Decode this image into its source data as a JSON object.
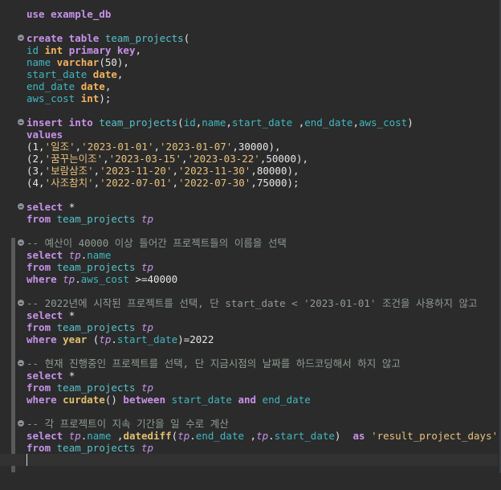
{
  "editor": {
    "lines": {
      "l1": [
        "use example_db"
      ],
      "l3": [
        "create table ",
        "team_projects",
        "("
      ],
      "l4": [
        "id ",
        "int ",
        "primary key",
        ","
      ],
      "l5": [
        "name ",
        "varchar",
        "(50),"
      ],
      "l6": [
        "start_date ",
        "date",
        ","
      ],
      "l7": [
        "end_date ",
        "date",
        ","
      ],
      "l8": [
        "aws_cost ",
        "int",
        ");"
      ],
      "l10": [
        "insert into ",
        "team_projects",
        "(",
        "id",
        ",",
        "name",
        ",",
        "start_date ",
        ",",
        "end_date",
        ",",
        "aws_cost",
        ")"
      ],
      "l11": [
        "values"
      ],
      "l12": [
        "(1,",
        "'일조'",
        ",",
        "'2023-01-01'",
        ",",
        "'2023-01-07'",
        ",30000),"
      ],
      "l13": [
        "(2,",
        "'꿈꾸는이조'",
        ",",
        "'2023-03-15'",
        ",",
        "'2023-03-22'",
        ",50000),"
      ],
      "l14": [
        "(3,",
        "'보람삼조'",
        ",",
        "'2023-11-20'",
        ",",
        "'2023-11-30'",
        ",80000),"
      ],
      "l15": [
        "(4,",
        "'사조참치'",
        ",",
        "'2022-07-01'",
        ",",
        "'2022-07-30'",
        ",75000);"
      ],
      "l17": [
        "select ",
        "*"
      ],
      "l18": [
        "from ",
        "team_projects ",
        "tp"
      ],
      "l20": [
        "-- 예산이 40000 이상 들어간 프로젝트들의 이름을 선택"
      ],
      "l21": [
        "select ",
        "tp",
        ".",
        "name"
      ],
      "l22": [
        "from ",
        "team_projects ",
        "tp"
      ],
      "l23": [
        "where ",
        "tp",
        ".",
        "aws_cost ",
        ">=40000"
      ],
      "l25": [
        "-- 2022년에 시작된 프로젝트를 선택, 단 start_date < '2023-01-01' 조건을 사용하지 않고"
      ],
      "l26": [
        "select ",
        "*"
      ],
      "l27": [
        "from ",
        "team_projects ",
        "tp"
      ],
      "l28": [
        "where ",
        "year ",
        "(",
        "tp",
        ".",
        "start_date",
        ")=2022"
      ],
      "l30": [
        "-- 현재 진행중인 프로젝트를 선택, 단 지금시점의 날짜를 하드코딩해서 하지 않고"
      ],
      "l31": [
        "select ",
        "*"
      ],
      "l32": [
        "from ",
        "team_projects ",
        "tp"
      ],
      "l33": [
        "where ",
        "curdate",
        "() ",
        "between ",
        "start_date ",
        "and ",
        "end_date"
      ],
      "l35": [
        "-- 각 프로젝트이 지속 기간을 일 수로 계산"
      ],
      "l36": [
        "select ",
        "tp",
        ".",
        "name ",
        ",",
        "datediff",
        "(",
        "tp",
        ".",
        "end_date ",
        ",",
        "tp",
        ".",
        "start_date",
        ")  ",
        "as ",
        "'result_project_days'"
      ],
      "l37": [
        "from ",
        "team_projects ",
        "tp"
      ]
    }
  }
}
